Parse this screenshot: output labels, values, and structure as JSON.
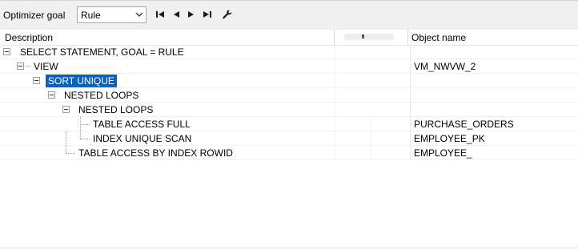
{
  "toolbar": {
    "optimizer_goal_label": "Optimizer goal",
    "goal_select_value": "Rule",
    "icons": [
      "first-icon",
      "previous-icon",
      "next-icon",
      "last-icon",
      "wrench-icon"
    ]
  },
  "columns": {
    "description": "Description",
    "object_name": "Object name"
  },
  "rows": [
    {
      "description": "SELECT STATEMENT, GOAL = RULE",
      "object": ""
    },
    {
      "description": "VIEW",
      "object": "VM_NWVW_2"
    },
    {
      "description": "SORT UNIQUE",
      "object": ""
    },
    {
      "description": "NESTED LOOPS",
      "object": ""
    },
    {
      "description": "NESTED LOOPS",
      "object": ""
    },
    {
      "description": "TABLE ACCESS FULL",
      "object": "PURCHASE_ORDERS"
    },
    {
      "description": "INDEX UNIQUE SCAN",
      "object": "EMPLOYEE_PK"
    },
    {
      "description": "TABLE ACCESS BY INDEX ROWID",
      "object": "EMPLOYEE_"
    }
  ],
  "colors": {
    "selection": "#0a63b8",
    "toolbar_bg": "#f0f0f0"
  }
}
